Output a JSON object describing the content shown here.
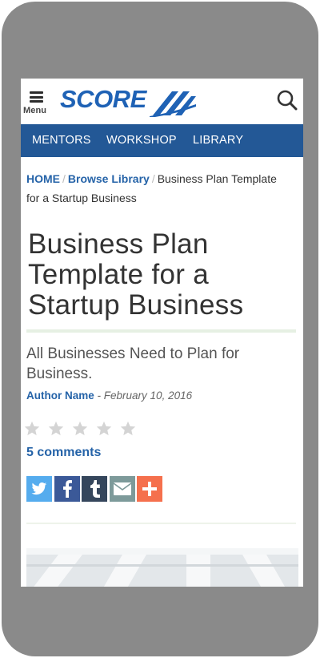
{
  "header": {
    "menu_label": "Menu",
    "logo_text": "SCORE"
  },
  "nav": {
    "items": [
      {
        "label": "MENTORS"
      },
      {
        "label": "WORKSHOP"
      },
      {
        "label": "LIBRARY"
      }
    ]
  },
  "breadcrumb": {
    "home": "HOME",
    "library": "Browse Library",
    "current": "Business Plan Template for a Startup Business",
    "separator": "/"
  },
  "article": {
    "title": "Business Plan Template for a Startup Business",
    "subtitle": "All Businesses Need to Plan for Business.",
    "author": "Author Name",
    "date": "- February 10, 2016",
    "rating": 0,
    "rating_max": 5,
    "comments": "5 comments"
  },
  "share": [
    {
      "icon": "twitter-icon",
      "color": "#55acee"
    },
    {
      "icon": "facebook-icon",
      "color": "#3b5998"
    },
    {
      "icon": "tumblr-icon",
      "color": "#35465c"
    },
    {
      "icon": "email-icon",
      "color": "#7d9a9a"
    },
    {
      "icon": "plus-icon",
      "color": "#f5704d"
    }
  ],
  "colors": {
    "brand_blue": "#1f62b5",
    "nav_bg": "#235896",
    "link": "#2563a8",
    "star_empty": "#d4d4d4"
  }
}
